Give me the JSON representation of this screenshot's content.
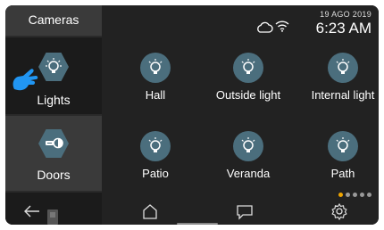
{
  "sidebar": {
    "cameras_label": "Cameras",
    "lights_label": "Lights",
    "doors_label": "Doors"
  },
  "status": {
    "date": "19 AGO 2019",
    "time": "6:23 AM"
  },
  "tiles": [
    {
      "label": "Hall",
      "icon": "bulb-icon"
    },
    {
      "label": "Outside light",
      "icon": "bulb-icon"
    },
    {
      "label": "Internal light",
      "icon": "bulb-icon"
    },
    {
      "label": "Patio",
      "icon": "bulb-icon"
    },
    {
      "label": "Veranda",
      "icon": "bulb-icon"
    },
    {
      "label": "Path",
      "icon": "bulb-icon"
    }
  ],
  "pager": {
    "pages": 5,
    "active": 1
  },
  "nav": {
    "back_icon": "back-arrow-icon",
    "home_icon": "home-icon",
    "chat_icon": "chat-icon",
    "settings_icon": "gear-icon"
  },
  "colors": {
    "accent": "#4b6e7d",
    "active_dot": "#f0a500",
    "pointer": "#2196f3"
  }
}
